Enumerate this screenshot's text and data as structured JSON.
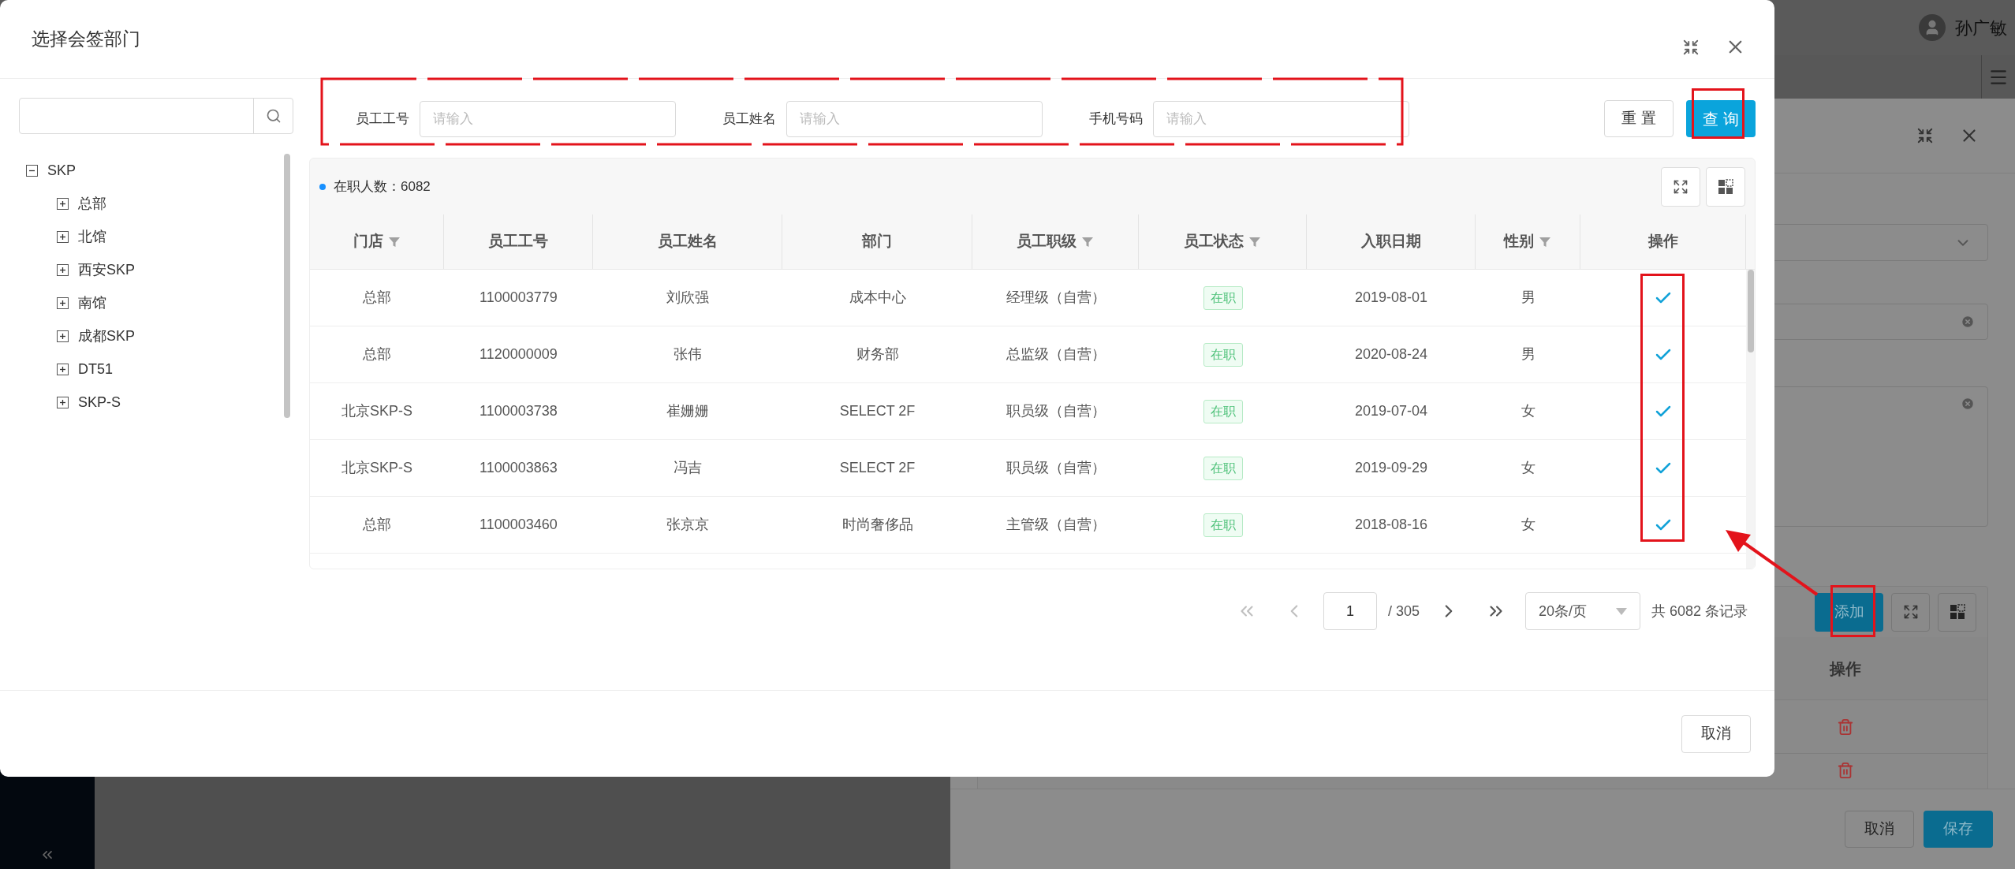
{
  "app": {
    "user": {
      "name": "孙广敏"
    }
  },
  "drawer": {
    "add_button": "添加",
    "column_header": "操作",
    "buttons": [
      {
        "label": "取消",
        "kind": "default"
      },
      {
        "label": "保存",
        "kind": "primary"
      }
    ]
  },
  "dialog": {
    "title": "选择会签部门"
  },
  "tree": [
    {
      "label": "SKP",
      "expanded": true,
      "children": [
        {
          "label": "总部",
          "expanded": false
        },
        {
          "label": "北馆",
          "expanded": false
        },
        {
          "label": "西安SKP",
          "expanded": false
        },
        {
          "label": "南馆",
          "expanded": false
        },
        {
          "label": "成都SKP",
          "expanded": false
        },
        {
          "label": "DT51",
          "expanded": false
        },
        {
          "label": "SKP-S",
          "expanded": false
        }
      ]
    }
  ],
  "filters": [
    {
      "label": "员工工号",
      "placeholder": "请输入"
    },
    {
      "label": "员工姓名",
      "placeholder": "请输入"
    },
    {
      "label": "手机号码",
      "placeholder": "请输入"
    }
  ],
  "form_buttons": [
    {
      "label": "重 置",
      "kind": "default"
    },
    {
      "label": "查 询",
      "kind": "primary"
    }
  ],
  "table": {
    "summary": "在职人数：6082",
    "columns": [
      {
        "label": "门店",
        "kind": "text",
        "filter": true
      },
      {
        "label": "员工工号",
        "kind": "text",
        "filter": false
      },
      {
        "label": "员工姓名",
        "kind": "text",
        "filter": false
      },
      {
        "label": "部门",
        "kind": "text",
        "filter": false
      },
      {
        "label": "员工职级",
        "kind": "text",
        "filter": true
      },
      {
        "label": "员工状态",
        "kind": "tag",
        "filter": true
      },
      {
        "label": "入职日期",
        "kind": "text",
        "filter": false
      },
      {
        "label": "性别",
        "kind": "text",
        "filter": true
      },
      {
        "label": "操作",
        "kind": "action",
        "filter": false
      }
    ],
    "rows": [
      {
        "cells": [
          "总部",
          "1100003779",
          "刘欣强",
          "成本中心",
          "经理级（自营）",
          "在职",
          "2019-08-01",
          "男"
        ]
      },
      {
        "cells": [
          "总部",
          "1120000009",
          "张伟",
          "财务部",
          "总监级（自营）",
          "在职",
          "2020-08-24",
          "男"
        ]
      },
      {
        "cells": [
          "北京SKP-S",
          "1100003738",
          "崔姗姗",
          "SELECT 2F",
          "职员级（自营）",
          "在职",
          "2019-07-04",
          "女"
        ]
      },
      {
        "cells": [
          "北京SKP-S",
          "1100003863",
          "冯吉",
          "SELECT 2F",
          "职员级（自营）",
          "在职",
          "2019-09-29",
          "女"
        ]
      },
      {
        "cells": [
          "总部",
          "1100003460",
          "张京京",
          "时尚奢侈品",
          "主管级（自营）",
          "在职",
          "2018-08-16",
          "女"
        ]
      }
    ]
  },
  "pagination": {
    "nav": [
      {
        "kind": "first",
        "disabled": true
      },
      {
        "kind": "prev",
        "disabled": true
      },
      {
        "kind": "next",
        "disabled": false
      },
      {
        "kind": "last",
        "disabled": false
      }
    ],
    "page": "1",
    "total_pages": "/ 305",
    "page_size": "20条/页",
    "total": "共 6082 条记录"
  },
  "footer": {
    "cancel": "取消"
  }
}
